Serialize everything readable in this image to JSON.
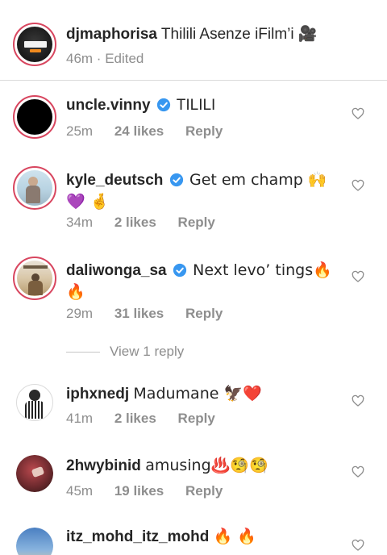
{
  "post": {
    "username": "djmaphorisa",
    "caption": "Thilili Asenze iFilm’i",
    "caption_emoji": "🎥",
    "time": "46m",
    "edited": "Edited"
  },
  "comments": [
    {
      "username": "uncle.vinny",
      "verified": true,
      "text": "TILILI",
      "time": "25m",
      "likes": "24 likes",
      "reply": "Reply"
    },
    {
      "username": "kyle_deutsch",
      "verified": true,
      "text": "Get em champ 🙌 💜 🤞",
      "time": "34m",
      "likes": "2 likes",
      "reply": "Reply"
    },
    {
      "username": "daliwonga_sa",
      "verified": true,
      "text": "Next levo’ tings🔥 🔥",
      "time": "29m",
      "likes": "31 likes",
      "reply": "Reply"
    },
    {
      "username": "iphxnedj",
      "verified": false,
      "text": "Madumane 🦅❤️",
      "time": "41m",
      "likes": "2 likes",
      "reply": "Reply"
    },
    {
      "username": "2hwybinid",
      "verified": false,
      "text": "amusing♨️🧐🧐",
      "time": "45m",
      "likes": "19 likes",
      "reply": "Reply"
    },
    {
      "username": "itz_mohd_itz_mohd",
      "verified": false,
      "text": "🔥 🔥",
      "time": "",
      "likes": "",
      "reply": ""
    }
  ],
  "view_replies": "View 1 reply",
  "colors": {
    "verified": "#3897f0",
    "story_ring": "#d8465f",
    "muted": "#8e8e8e"
  },
  "icons": {
    "verified": "verified-badge-icon",
    "like": "heart-outline-icon"
  }
}
